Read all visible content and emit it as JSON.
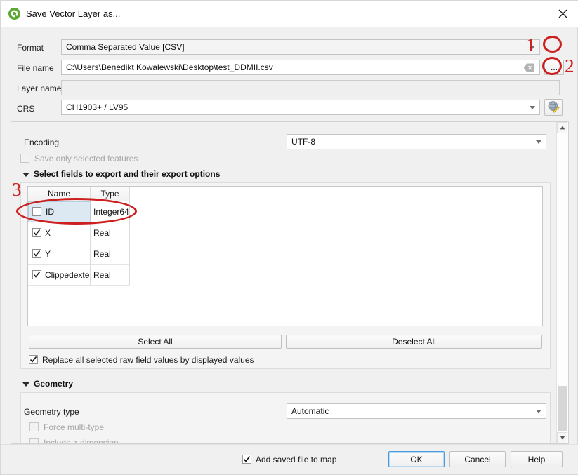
{
  "window": {
    "title": "Save Vector Layer as...",
    "logo_icon": "qgis-logo-icon",
    "close_icon": "close-icon"
  },
  "form": {
    "format": {
      "label": "Format",
      "value": "Comma Separated Value [CSV]",
      "dropdown_icon": "chevron-down-icon"
    },
    "file_name": {
      "label": "File name",
      "value": "C:\\Users\\Benedikt Kowalewski\\Desktop\\test_DDMII.csv",
      "clear_icon": "clear-backspace-icon",
      "browse_label": "..."
    },
    "layer_name": {
      "label": "Layer name",
      "value": "",
      "placeholder": ""
    },
    "crs": {
      "label": "CRS",
      "value": "CH1903+ / LV95",
      "dropdown_icon": "chevron-down-icon",
      "select_crs_icon": "globe-edit-icon"
    }
  },
  "options": {
    "encoding": {
      "label": "Encoding",
      "value": "UTF-8",
      "dropdown_icon": "chevron-down-icon"
    },
    "save_only_selected": {
      "label": "Save only selected features",
      "checked": false,
      "enabled": false
    },
    "fields_section": {
      "title": "Select fields to export and their export options",
      "collapse_icon": "triangle-down-icon",
      "table": {
        "columns": [
          "Name",
          "Type"
        ],
        "rows": [
          {
            "name": "ID",
            "type": "Integer64",
            "checked": false,
            "selected": true
          },
          {
            "name": "X",
            "type": "Real",
            "checked": true,
            "selected": false
          },
          {
            "name": "Y",
            "type": "Real",
            "checked": true,
            "selected": false
          },
          {
            "name": "Clippedexte",
            "type": "Real",
            "checked": true,
            "selected": false
          }
        ]
      },
      "select_all_label": "Select All",
      "deselect_all_label": "Deselect All",
      "replace_raw_values": {
        "label": "Replace all selected raw field values by displayed values",
        "checked": true
      }
    },
    "geometry_section": {
      "title": "Geometry",
      "collapse_icon": "triangle-down-icon",
      "geometry_type": {
        "label": "Geometry type",
        "value": "Automatic",
        "dropdown_icon": "chevron-down-icon"
      },
      "force_multi_type": {
        "label": "Force multi-type",
        "checked": false,
        "enabled": false
      },
      "include_z_dimension": {
        "label": "Include z-dimension",
        "checked": false,
        "enabled": false
      }
    },
    "scrollbar": {
      "up_icon": "scroll-up-arrow-icon",
      "down_icon": "scroll-down-arrow-icon"
    }
  },
  "footer": {
    "add_saved_file": {
      "label": "Add saved file to map",
      "checked": true
    },
    "ok_label": "OK",
    "cancel_label": "Cancel",
    "help_label": "Help"
  },
  "annotations": {
    "marker_1": "1",
    "marker_2": "2",
    "marker_3": "3",
    "color": "#cc1f1f"
  }
}
